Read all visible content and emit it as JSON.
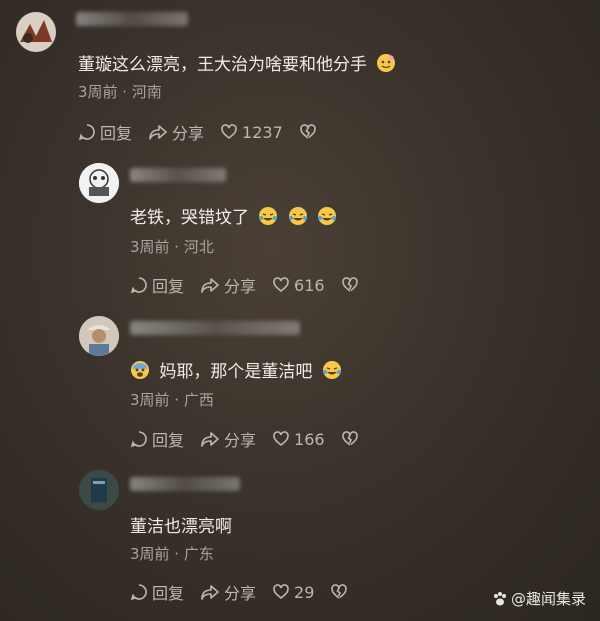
{
  "comments": [
    {
      "text": "董璇这么漂亮，王大治为啥要和他分手",
      "meta": "3周前 · 河南",
      "reply": "回复",
      "share": "分享",
      "likes": "1237"
    },
    {
      "text": "老铁，哭错坟了",
      "meta": "3周前 · 河北",
      "reply": "回复",
      "share": "分享",
      "likes": "616"
    },
    {
      "text": "妈耶，那个是董洁吧",
      "meta": "3周前 · 广西",
      "reply": "回复",
      "share": "分享",
      "likes": "166"
    },
    {
      "text": "董洁也漂亮啊",
      "meta": "3周前 · 广东",
      "reply": "回复",
      "share": "分享",
      "likes": "29"
    }
  ],
  "watermark": "@趣闻集录",
  "colors": {
    "background": "#3a322b",
    "text": "#f0ece8",
    "meta": "#a9a39c"
  }
}
